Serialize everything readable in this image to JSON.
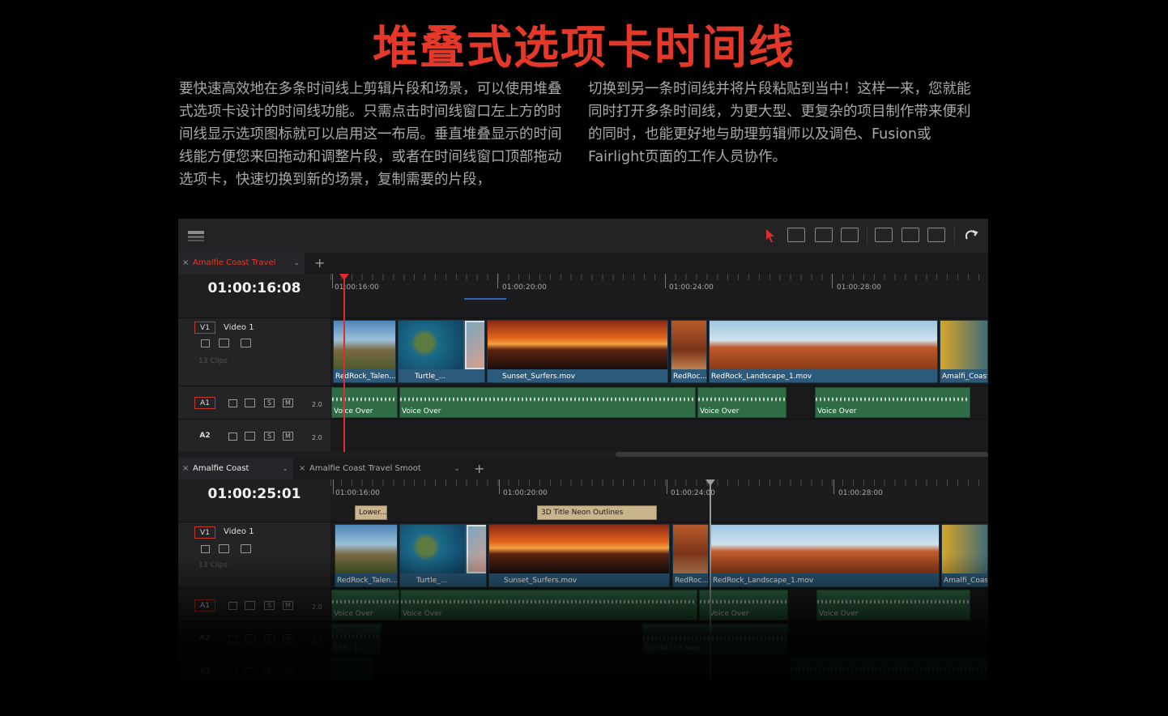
{
  "heading": "堆叠式选项卡时间线",
  "paragraph_left": "要快速高效地在多条时间线上剪辑片段和场景，可以使用堆叠式选项卡设计的时间线功能。只需点击时间线窗口左上方的时间线显示选项图标就可以启用这一布局。垂直堆叠显示的时间线能方便您来回拖动和调整片段，或者在时间线窗口顶部拖动选项卡，快速切换到新的场景，复制需要的片段，",
  "paragraph_right": "切换到另一条时间线并将片段粘贴到当中！这样一来，您就能同时打开多条时间线，为更大型、更复杂的项目制作带来便利的同时，也能更好地与助理剪辑师以及调色、Fusion或Fairlight页面的工作人员协作。",
  "colors": {
    "accent": "#e4392a",
    "video_clip": "#2b5a7a",
    "audio_clip": "#2f6b45",
    "title_clip": "#c9b48c"
  },
  "toolbar": {
    "icons": [
      "timeline-view-icon",
      "selection-arrow-icon",
      "trim-edit-icon",
      "dynamic-trim-icon",
      "blade-icon",
      "insert-icon",
      "overwrite-icon",
      "replace-icon",
      "snapping-icon"
    ]
  },
  "top": {
    "tab_close": "×",
    "tab_chevron": "⌄",
    "tab_label": "Amalfie Coast Travel Edit",
    "add": "+",
    "timecode": "01:00:16:08",
    "ruler": [
      "01:00:16:00",
      "01:00:20:00",
      "01:00:24:00",
      "01:00:28:00"
    ],
    "v1": {
      "badge": "V1",
      "name": "Video 1",
      "count": "13 Clips"
    },
    "a1": {
      "badge": "A1",
      "level": "2.0",
      "s": "S",
      "m": "M"
    },
    "a2": {
      "badge": "A2",
      "level": "2.0",
      "s": "S",
      "m": "M"
    },
    "video_clips": [
      "RedRock_Talen...",
      "Turtle_...",
      "Sunset_Surfers.mov",
      "RedRoc...",
      "RedRock_Landscape_1.mov",
      "Amalfi_Coast"
    ],
    "audio_clips": [
      "Voice Over",
      "Voice Over",
      "Voice Over",
      "Voice Over"
    ]
  },
  "bottom": {
    "tab1_label": "Amalfie Coast Travel_",
    "tab2_label": "Amalfie Coast Travel Smoot Animate",
    "add": "+",
    "timecode": "01:00:25:01",
    "ruler": [
      "01:00:16:00",
      "01:00:20:00",
      "01:00:24:00",
      "01:00:28:00"
    ],
    "title_clips": [
      "Lower...",
      "3D Title Neon Outlines"
    ],
    "v1": {
      "badge": "V1",
      "name": "Video 1",
      "count": "13 Clips"
    },
    "a1": {
      "badge": "A1",
      "level": "2.0",
      "s": "S",
      "m": "M"
    },
    "a2": {
      "badge": "A2",
      "level": "2.0",
      "s": "S",
      "m": "M"
    },
    "a3": {
      "badge": "A3",
      "level": "2.0",
      "s": "S",
      "m": "M"
    },
    "video_clips": [
      "RedRock_Talen...",
      "Turtle_...",
      "Sunset_Surfers.mov",
      "RedRoc...",
      "RedRock_Landscape_1.mov",
      "Amalfi_Coast"
    ],
    "audio_clips": [
      "Voice Over",
      "Voice Over",
      "Voice Over",
      "Voice Over"
    ],
    "a2_clips": [
      "SFX - J...",
      "SOUND FX.wav"
    ]
  }
}
